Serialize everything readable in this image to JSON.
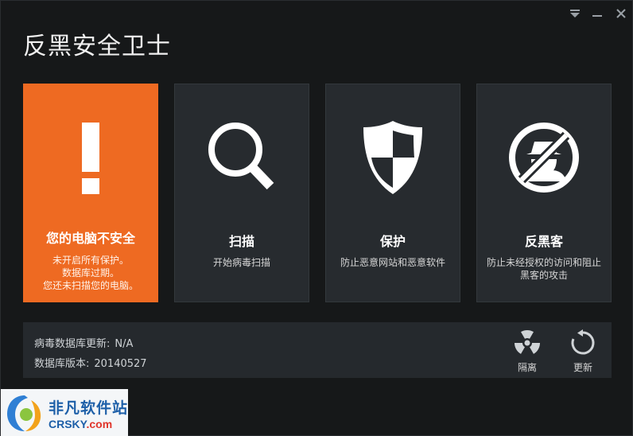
{
  "app": {
    "title": "反黑安全卫士"
  },
  "window_controls": {
    "menu_icon": "dropdown-triangle-icon",
    "minimize_icon": "minimize-icon",
    "close_icon": "close-icon"
  },
  "tiles": [
    {
      "title": "您的电脑不安全",
      "desc_lines": [
        "未开启所有保护。",
        "数据库过期。",
        "您还未扫描您的电脑。"
      ],
      "icon": "exclamation-icon",
      "color": "#ee6a22"
    },
    {
      "title": "扫描",
      "desc_lines": [
        "开始病毒扫描"
      ],
      "icon": "magnifier-icon"
    },
    {
      "title": "保护",
      "desc_lines": [
        "防止恶意网站和恶意软件"
      ],
      "icon": "shield-icon"
    },
    {
      "title": "反黑客",
      "desc_lines": [
        "防止未经授权的访问和阻止",
        "黑客的攻击"
      ],
      "icon": "no-hacker-icon"
    }
  ],
  "info": {
    "virus_db_update_label": "病毒数据库更新:",
    "virus_db_update_value": "N/A",
    "db_version_label": "数据库版本:",
    "db_version_value": "20140527"
  },
  "tools": {
    "quarantine_label": "隔离",
    "quarantine_icon": "radiation-icon",
    "update_label": "更新",
    "update_icon": "refresh-icon"
  },
  "watermark": {
    "cn": "非凡软件站",
    "en_main": "CRSKY",
    "en_suffix": ".com"
  }
}
